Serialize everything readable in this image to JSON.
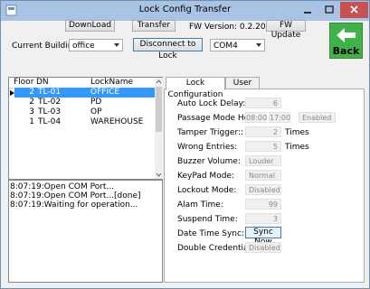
{
  "window": {
    "title": "Lock Config Transfer"
  },
  "toolbar": {
    "download_label": "DownLoad",
    "transfer_label": "Transfer",
    "fw_version": "FW Version: 0.2.20",
    "fw_update_label": "FW Update",
    "current_building_label": "Current Building:",
    "building_value": "office",
    "disconnect_label": "Disconnect to Lock",
    "port_value": "COM4",
    "back_label": "Back"
  },
  "lock_table": {
    "columns": [
      "Floor",
      "DN",
      "LockName"
    ],
    "rows": [
      {
        "floor": "2",
        "dn": "TL-01",
        "name": "OFFICE",
        "selected": true
      },
      {
        "floor": "2",
        "dn": "TL-02",
        "name": "PD",
        "selected": false
      },
      {
        "floor": "3",
        "dn": "TL-03",
        "name": "OP",
        "selected": false
      },
      {
        "floor": "1",
        "dn": "TL-04",
        "name": "WAREHOUSE",
        "selected": false
      }
    ]
  },
  "log": {
    "lines": [
      "8:07:19:Open COM Port...",
      "8:07:19:Open COM Port...[done]",
      "8:07:19:Waiting for operation..."
    ]
  },
  "tabs": [
    {
      "label": "Lock Configuration",
      "active": true
    },
    {
      "label": "User Data",
      "active": false
    }
  ],
  "lock_config": {
    "auto_lock_delay": {
      "label": "Auto Lock Delay:",
      "value": "6"
    },
    "passage_mode_hour": {
      "label": "Passage Mode Hour:",
      "start": "08:00",
      "end": "17:00",
      "status": "Enabled"
    },
    "tamper_trigger": {
      "label": "Tamper Trigger::",
      "value": "2",
      "unit": "Times"
    },
    "wrong_entries": {
      "label": "Wrong Entries:",
      "value": "5",
      "unit": "Times"
    },
    "buzzer_volume": {
      "label": "Buzzer Volume:",
      "value": "Louder"
    },
    "keypad_mode": {
      "label": "KeyPad Mode:",
      "value": "Normal"
    },
    "lockout_mode": {
      "label": "Lockout Mode:",
      "value": "Disabled"
    },
    "alarm_time": {
      "label": "Alam Time:",
      "value": "99"
    },
    "suspend_time": {
      "label": "Suspend Time:",
      "value": "3"
    },
    "date_time_sync": {
      "label": "Date Time Sync:",
      "button": "Sync Now"
    },
    "double_credential": {
      "label": "Double Credential:",
      "value": "Disabled"
    }
  },
  "colors": {
    "titlebar": "#a9c3e4",
    "close_button": "#c75050",
    "back_button": "#3fb34a",
    "selection": "#3399ff"
  }
}
